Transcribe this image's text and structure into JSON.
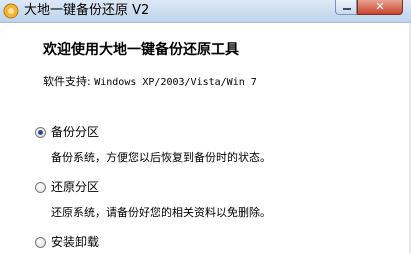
{
  "window": {
    "title": "大地一键备份还原 V2",
    "close_glyph": "✕"
  },
  "content": {
    "heading": "欢迎使用大地一键备份还原工具",
    "support_label": "软件支持:",
    "support_systems": "Windows XP/2003/Vista/Win 7"
  },
  "options": [
    {
      "label": "备份分区",
      "description": "备份系统，方便您以后恢复到备份时的状态。",
      "checked": true
    },
    {
      "label": "还原分区",
      "description": "还原系统，请备份好您的相关资料以免删除。",
      "checked": false
    },
    {
      "label": "安装卸载",
      "checked": false
    }
  ],
  "colors": {
    "radio_dot": "#2b4f8c",
    "close_button": "#c9442c",
    "titlebar": "#dde9f6"
  }
}
